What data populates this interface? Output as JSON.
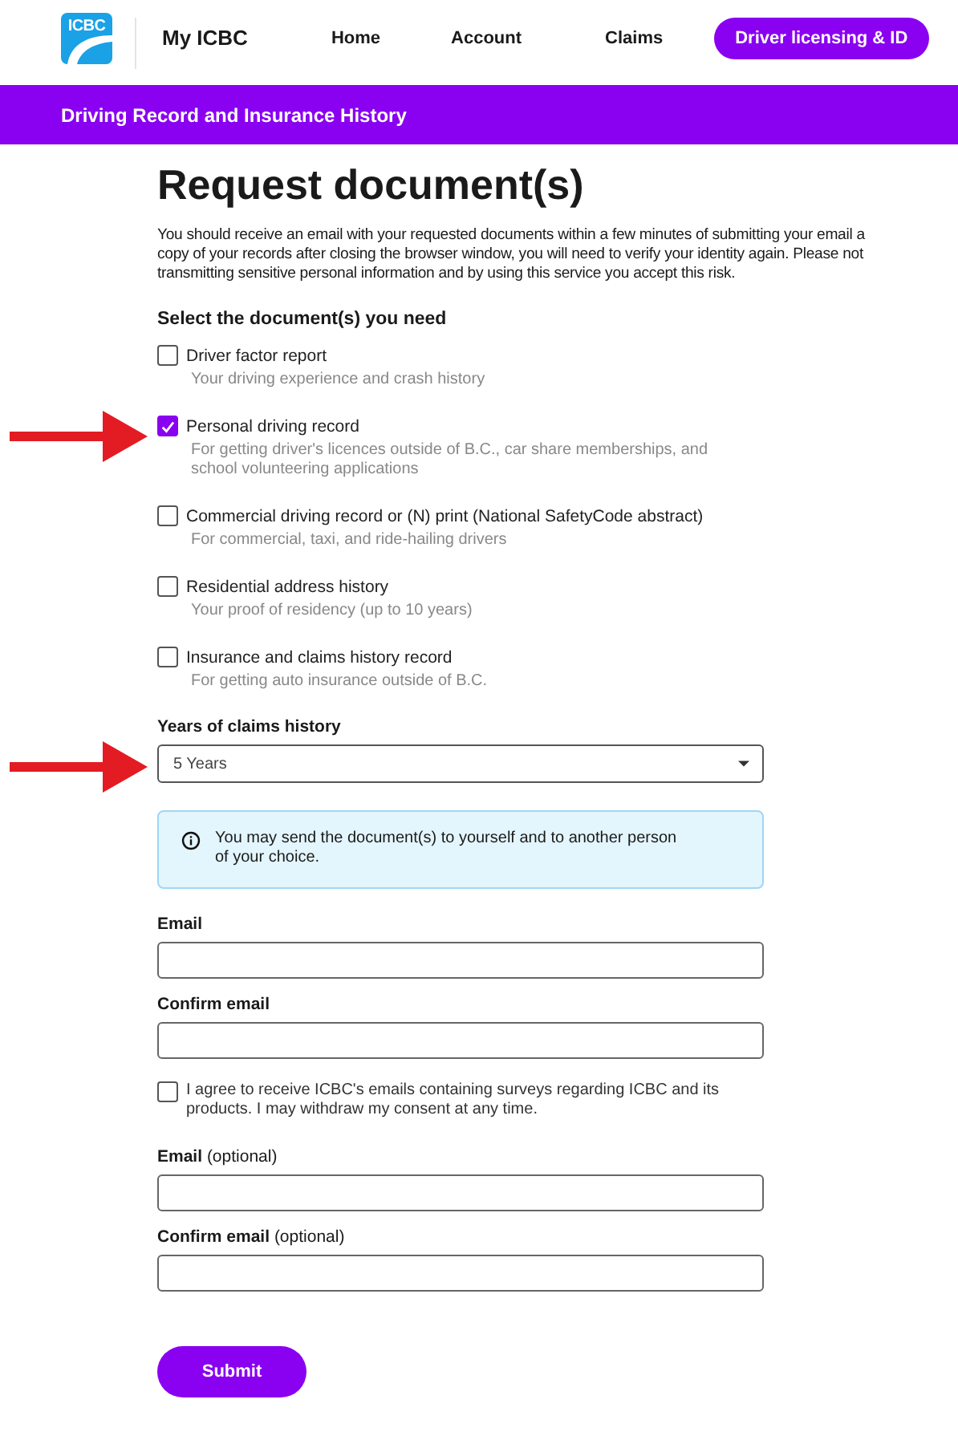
{
  "header": {
    "logo": "ICBC",
    "app_name": "My ICBC",
    "nav": [
      {
        "label": "Home",
        "selected": false
      },
      {
        "label": "Account",
        "selected": false
      },
      {
        "label": "Claims",
        "selected": false
      },
      {
        "label": "Driver licensing & ID",
        "selected": true
      }
    ]
  },
  "banner": "Driving Record and Insurance History",
  "title": "Request document(s)",
  "intro_lines": [
    "You should receive an email with your requested documents within a few minutes of submitting your email a",
    "copy of your records after closing the browser window, you will need to verify your identity again. Please not",
    "transmitting sensitive personal information and by using this service you accept this risk."
  ],
  "documents": {
    "heading": "Select the document(s) you need",
    "items": [
      {
        "label": "Driver factor report",
        "description": "Your driving experience and crash history",
        "checked": false,
        "annotated": false
      },
      {
        "label": "Personal driving record",
        "description": "For getting driver's licences outside of B.C., car share memberships, and school volunteering applications",
        "checked": true,
        "annotated": true
      },
      {
        "label": "Commercial driving record or (N) print (National SafetyCode abstract)",
        "description": "For commercial, taxi, and ride-hailing drivers",
        "checked": false,
        "annotated": false
      },
      {
        "label": "Residential address history",
        "description": "Your proof of residency (up to 10 years)",
        "checked": false,
        "annotated": false
      },
      {
        "label": "Insurance and claims history record",
        "description": "For getting auto insurance outside of B.C.",
        "checked": false,
        "annotated": false
      }
    ]
  },
  "claims_years": {
    "label": "Years of claims history",
    "value": "5 Years",
    "annotated": true
  },
  "info_note": "You may send the document(s) to yourself and to another person of your choice.",
  "email": {
    "label": "Email"
  },
  "confirm_email": {
    "label": "Confirm email"
  },
  "consent": {
    "text": "I agree to receive ICBC's emails containing surveys regarding ICBC and its products. I may withdraw my consent at any time.",
    "checked": false
  },
  "email_optional": {
    "label": "Email",
    "suffix": "(optional)"
  },
  "confirm_email_optional": {
    "label": "Confirm email",
    "suffix": "(optional)"
  },
  "submit": "Submit"
}
